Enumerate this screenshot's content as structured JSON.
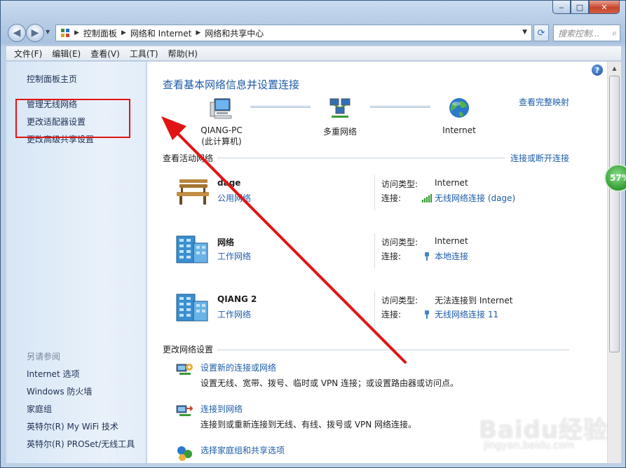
{
  "window": {
    "caption": {
      "minimize": "‒",
      "maximize": "□",
      "close": "✕"
    }
  },
  "address": {
    "crumbs": [
      "控制面板",
      "网络和 Internet",
      "网络和共享中心"
    ],
    "search_placeholder": "搜索控制..."
  },
  "menu": [
    "文件(F)",
    "编辑(E)",
    "查看(V)",
    "工具(T)",
    "帮助(H)"
  ],
  "sidebar": {
    "home": "控制面板主页",
    "items": [
      "管理无线网络",
      "更改适配器设置",
      "更改高级共享设置"
    ],
    "see_also_title": "另请参阅",
    "see_also": [
      "Internet 选项",
      "Windows 防火墙",
      "家庭组",
      "英特尔(R) My WiFi 技术",
      "英特尔(R) PROSet/无线工具"
    ]
  },
  "main": {
    "title": "查看基本网络信息并设置连接",
    "view_full_map": "查看完整映射",
    "map_nodes": [
      {
        "label": "QIANG-PC",
        "sub": "(此计算机)"
      },
      {
        "label": "多重网络",
        "sub": ""
      },
      {
        "label": "Internet",
        "sub": ""
      }
    ],
    "active_head": "查看活动网络",
    "connect_disconnect": "连接或断开连接",
    "access_type_label": "访问类型:",
    "connection_label": "连接:",
    "networks": [
      {
        "name": "dage",
        "type": "公用网络",
        "access": "Internet",
        "connection": "无线网络连接 (dage)"
      },
      {
        "name": "网络",
        "type": "工作网络",
        "access": "Internet",
        "connection": "本地连接"
      },
      {
        "name": "QIANG  2",
        "type": "工作网络",
        "access": "无法连接到 Internet",
        "connection": "无线网络连接 11"
      }
    ],
    "change_head": "更改网络设置",
    "tasks": [
      {
        "link": "设置新的连接或网络",
        "desc": "设置无线、宽带、拨号、临时或 VPN 连接；或设置路由器或访问点。"
      },
      {
        "link": "连接到网络",
        "desc": "连接到或重新连接到无线、有线、拨号或 VPN 网络连接。"
      },
      {
        "link": "选择家庭组和共享选项",
        "desc": ""
      }
    ]
  },
  "overlay": {
    "gauge": "57%",
    "watermark": "Baidu经验",
    "watermark_url": "jingyan.baidu.com"
  },
  "colors": {
    "link": "#1e5ca8",
    "annotation": "#e11414"
  }
}
